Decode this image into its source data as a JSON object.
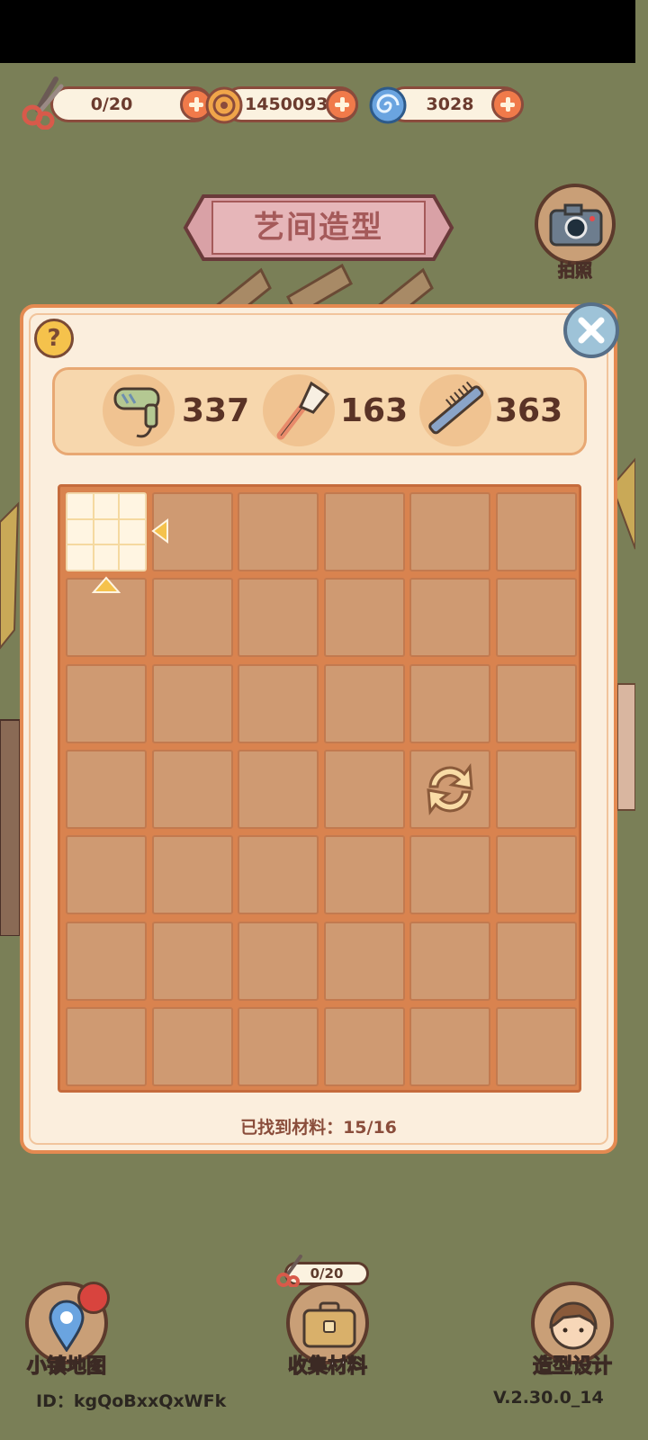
{
  "resources": {
    "scissors": {
      "value": "0/20",
      "icon": "scissors-icon"
    },
    "coins": {
      "value": "1450093",
      "icon": "coin-icon"
    },
    "spiral": {
      "value": "3028",
      "icon": "blue-spiral-icon"
    }
  },
  "title": "艺间造型",
  "camera_label": "拍照",
  "help_label": "?",
  "tools": [
    {
      "icon": "hair-dryer-icon",
      "count": "337"
    },
    {
      "icon": "makeup-brush-icon",
      "count": "163"
    },
    {
      "icon": "comb-icon",
      "count": "363"
    }
  ],
  "board": {
    "cols": 6,
    "rows": 7,
    "revealed_cells": [
      [
        0,
        0
      ]
    ]
  },
  "found_label": "已找到材料：15/16",
  "nav": {
    "map_label": "小镇地图",
    "collect_label": "收集材料",
    "collect_count": "0/20",
    "style_label": "造型设计"
  },
  "footer": {
    "id": "ID：kgQoBxxQxWFk",
    "version": "V.2.30.0_14"
  },
  "colors": {
    "background": "#7a7f57",
    "panel": "#fbeedd",
    "panel_border": "#e48a51",
    "cell": "#cf9a72",
    "grid": "#d9834f"
  }
}
